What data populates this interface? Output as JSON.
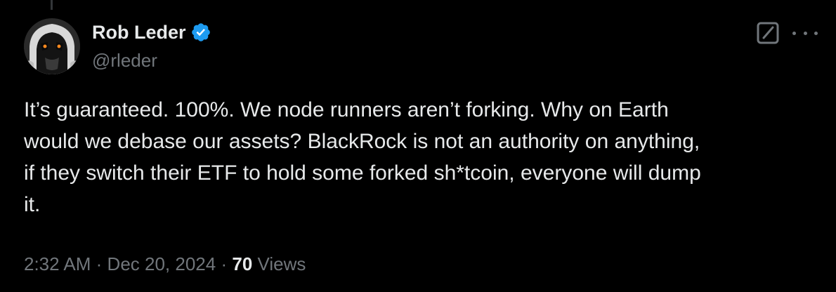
{
  "author": {
    "display_name": "Rob Leder",
    "handle": "@rleder",
    "verified": true,
    "avatar_icon": "masked-figure-avatar",
    "badge_color": "#1d9bf0"
  },
  "header_actions": {
    "grok_icon": "grok-icon",
    "more_icon": "more-options-icon"
  },
  "tweet": {
    "text": "It’s guaranteed. 100%. We node runners aren’t forking. Why on Earth\nwould we debase our assets? BlackRock is not an authority on anything,\nif they switch their ETF to hold some forked sh*tcoin, everyone will dump\nit."
  },
  "meta": {
    "time": "2:32 AM",
    "separator": "·",
    "date": "Dec 20, 2024",
    "views_count": "70",
    "views_label": "Views"
  },
  "colors": {
    "background": "#000000",
    "primary_text": "#e7e9ea",
    "secondary_text": "#71767b",
    "accent": "#1d9bf0"
  }
}
